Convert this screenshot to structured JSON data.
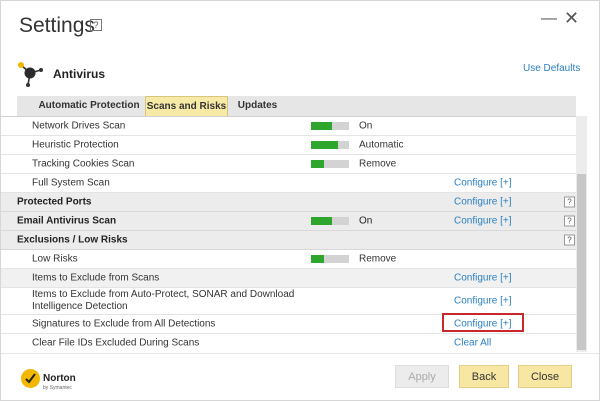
{
  "window": {
    "title": "Settings",
    "help_glyph": "?",
    "minimize_glyph": "—",
    "close_glyph": "✕"
  },
  "header": {
    "section_title": "Antivirus",
    "use_defaults": "Use Defaults",
    "icon": "antivirus-satellite-icon"
  },
  "tabs": [
    {
      "label": "Automatic Protection",
      "active": false
    },
    {
      "label": "Scans and Risks",
      "active": true
    },
    {
      "label": "Updates",
      "active": false
    }
  ],
  "rows": [
    {
      "label": "Network Drives Scan",
      "toggle_value": "On",
      "toggle_level": 0.55
    },
    {
      "label": "Heuristic Protection",
      "toggle_value": "Automatic",
      "toggle_level": 0.7
    },
    {
      "label": "Tracking Cookies Scan",
      "toggle_value": "Remove",
      "toggle_level": 0.35
    },
    {
      "label": "Full System Scan",
      "link": "Configure [+]"
    },
    {
      "label": "Protected Ports",
      "link": "Configure [+]",
      "help": "?"
    },
    {
      "label": "Email Antivirus Scan",
      "toggle_value": "On",
      "toggle_level": 0.55,
      "link": "Configure [+]",
      "help": "?"
    },
    {
      "label": "Exclusions / Low Risks",
      "help": "?"
    },
    {
      "label": "Low Risks",
      "toggle_value": "Remove",
      "toggle_level": 0.35
    },
    {
      "label": "Items to Exclude from Scans",
      "link": "Configure [+]"
    },
    {
      "label": "Items to Exclude from Auto-Protect, SONAR and Download Intelligence Detection",
      "link": "Configure [+]"
    },
    {
      "label": "Signatures to Exclude from All Detections",
      "link": "Configure [+]"
    },
    {
      "label": "Clear File IDs Excluded During Scans",
      "link": "Clear All"
    }
  ],
  "footer": {
    "brand": "Norton",
    "brand_sub": "by Symantec",
    "apply": "Apply",
    "back": "Back",
    "close": "Close"
  },
  "colors": {
    "accent_link": "#2a7fc0",
    "toggle_on": "#2ea62e",
    "button_bg": "#f8e7a3",
    "highlight": "#c8272c"
  }
}
